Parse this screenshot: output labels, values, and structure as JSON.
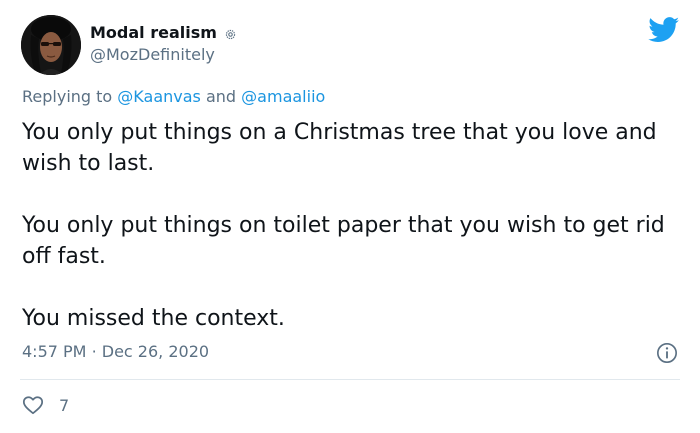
{
  "author": {
    "display_name": "Modal realism",
    "handle": "@MozDefinitely",
    "badge_icon": "gear-icon",
    "avatar_icon": "avatar-portrait"
  },
  "platform_icon": "twitter-bird-icon",
  "reply": {
    "prefix": "Replying to",
    "mention_1": "@Kaanvas",
    "joiner": "and",
    "mention_2": "@amaaliio"
  },
  "tweet": {
    "paragraphs": [
      "You only put things on a Christmas tree that you love and wish to last.",
      "You only put things on toilet paper that you wish to get rid off fast.",
      "You missed the context."
    ],
    "time": "4:57 PM",
    "separator": "·",
    "date": "Dec 26, 2020"
  },
  "actions": {
    "like_count": "7",
    "like_icon": "heart-icon",
    "info_icon": "info-icon"
  },
  "colors": {
    "text": "#0f1419",
    "secondary": "#5b7083",
    "link": "#1b95e0",
    "twitter_blue": "#1da1f2",
    "divider": "#e1e8ed"
  }
}
